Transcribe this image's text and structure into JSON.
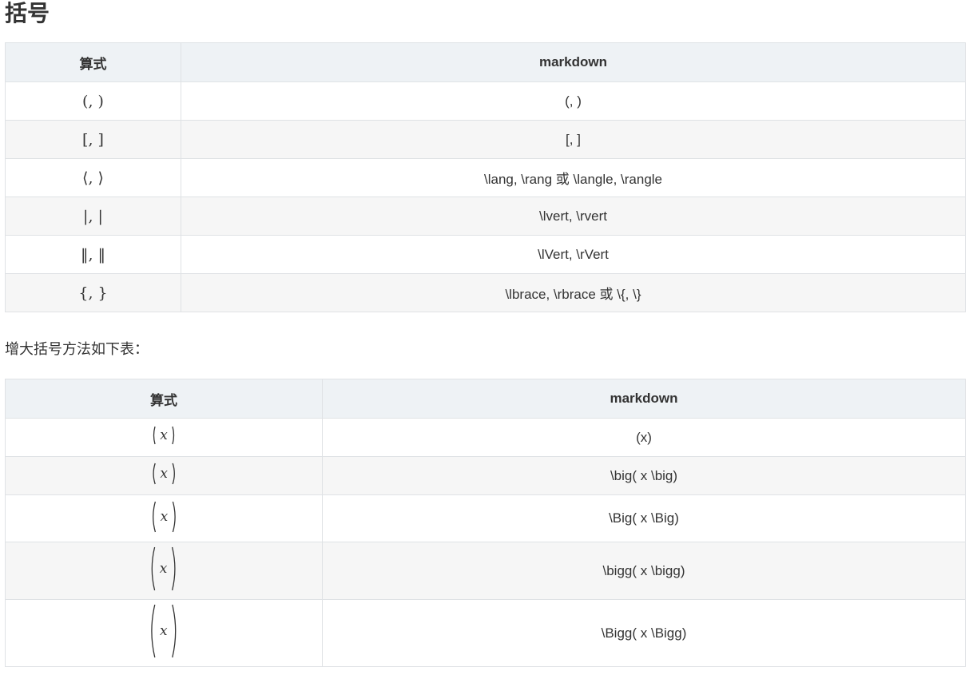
{
  "title": "括号",
  "table1": {
    "headers": [
      "算式",
      "markdown"
    ],
    "rows": [
      {
        "formula": "(, )",
        "markdown": "(, )"
      },
      {
        "formula": "[, ]",
        "markdown": "[, ]"
      },
      {
        "formula": "⟨, ⟩",
        "markdown": "\\lang, \\rang 或 \\langle, \\rangle"
      },
      {
        "formula": "|, |",
        "markdown": "\\lvert, \\rvert"
      },
      {
        "formula": "‖, ‖",
        "markdown": "\\lVert, \\rVert"
      },
      {
        "formula": "{, }",
        "markdown": "\\lbrace, \\rbrace 或 \\{, \\}"
      }
    ]
  },
  "intro_text": "增大括号方法如下表：",
  "table2": {
    "headers": [
      "算式",
      "markdown"
    ],
    "rows": [
      {
        "formula": "(x)",
        "variable": "x",
        "markdown": "(x)"
      },
      {
        "formula": "\\big( x \\big)",
        "variable": "x",
        "markdown": "\\big( x \\big)"
      },
      {
        "formula": "\\Big( x \\Big)",
        "variable": "x",
        "markdown": "\\Big( x \\Big)"
      },
      {
        "formula": "\\bigg( x \\bigg)",
        "variable": "x",
        "markdown": "\\bigg( x \\bigg)"
      },
      {
        "formula": "\\Bigg( x \\Bigg)",
        "variable": "x",
        "markdown": "\\Bigg( x \\Bigg)"
      }
    ]
  }
}
